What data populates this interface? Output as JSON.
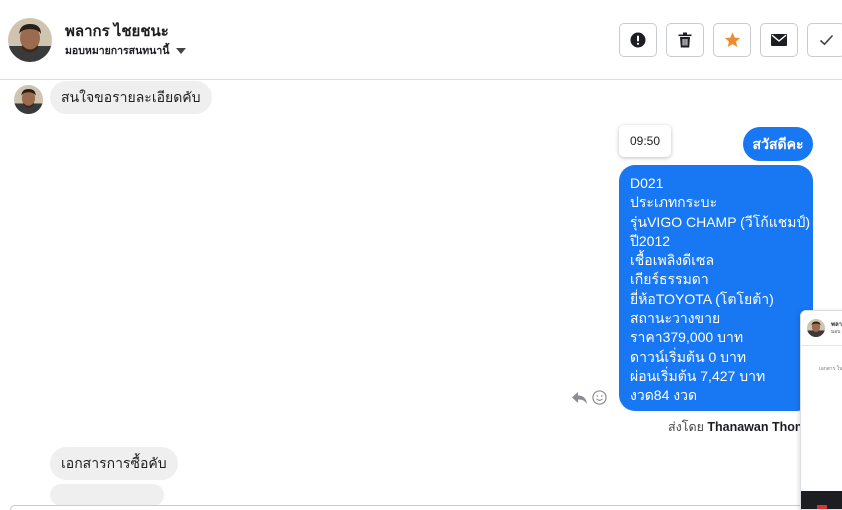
{
  "header": {
    "contact_name": "พลากร ไชยชนะ",
    "assign_label": "มอบหมายการสนทนานี้",
    "actions": [
      {
        "name": "report-button",
        "icon": "exclamation-circle-icon"
      },
      {
        "name": "delete-button",
        "icon": "trash-icon"
      },
      {
        "name": "star-button",
        "icon": "star-icon",
        "color": "#f08c2c"
      },
      {
        "name": "mark-unread-button",
        "icon": "envelope-icon"
      },
      {
        "name": "done-button",
        "icon": "check-icon"
      }
    ]
  },
  "messages": {
    "incoming_1": "สนใจขอรายละเอียดคับ",
    "outgoing_greeting": "สวัสดีคะ",
    "timestamp": "09:50",
    "outgoing_details": [
      "D021",
      "ประเภทกระบะ",
      "รุ่นVIGO CHAMP (วีโก้แชมป์)",
      "ปี2012",
      "เชื้อเพลิงดีเซล",
      "เกียร์ธรรมดา",
      "ยี่ห้อTOYOTA (โตโยต้า)",
      "สถานะวางขาย",
      "ราคา379,000 บาท",
      "ดาวน์เริ่มต้น 0 บาท",
      "ผ่อนเริ่มต้น 7,427 บาท",
      "งวด84 งวด"
    ],
    "sent_by_prefix": "ส่งโดย",
    "sent_by_name": "Thanawan Thon",
    "incoming_2": "เอกสารการซื้อคับ"
  },
  "preview": {
    "title": "พลา",
    "subtitle": "มอบ",
    "snippet": "เอกสาร ใน"
  },
  "colors": {
    "outgoing_bubble": "#1877f2",
    "incoming_bubble": "#efefef",
    "star": "#f08c2c"
  }
}
